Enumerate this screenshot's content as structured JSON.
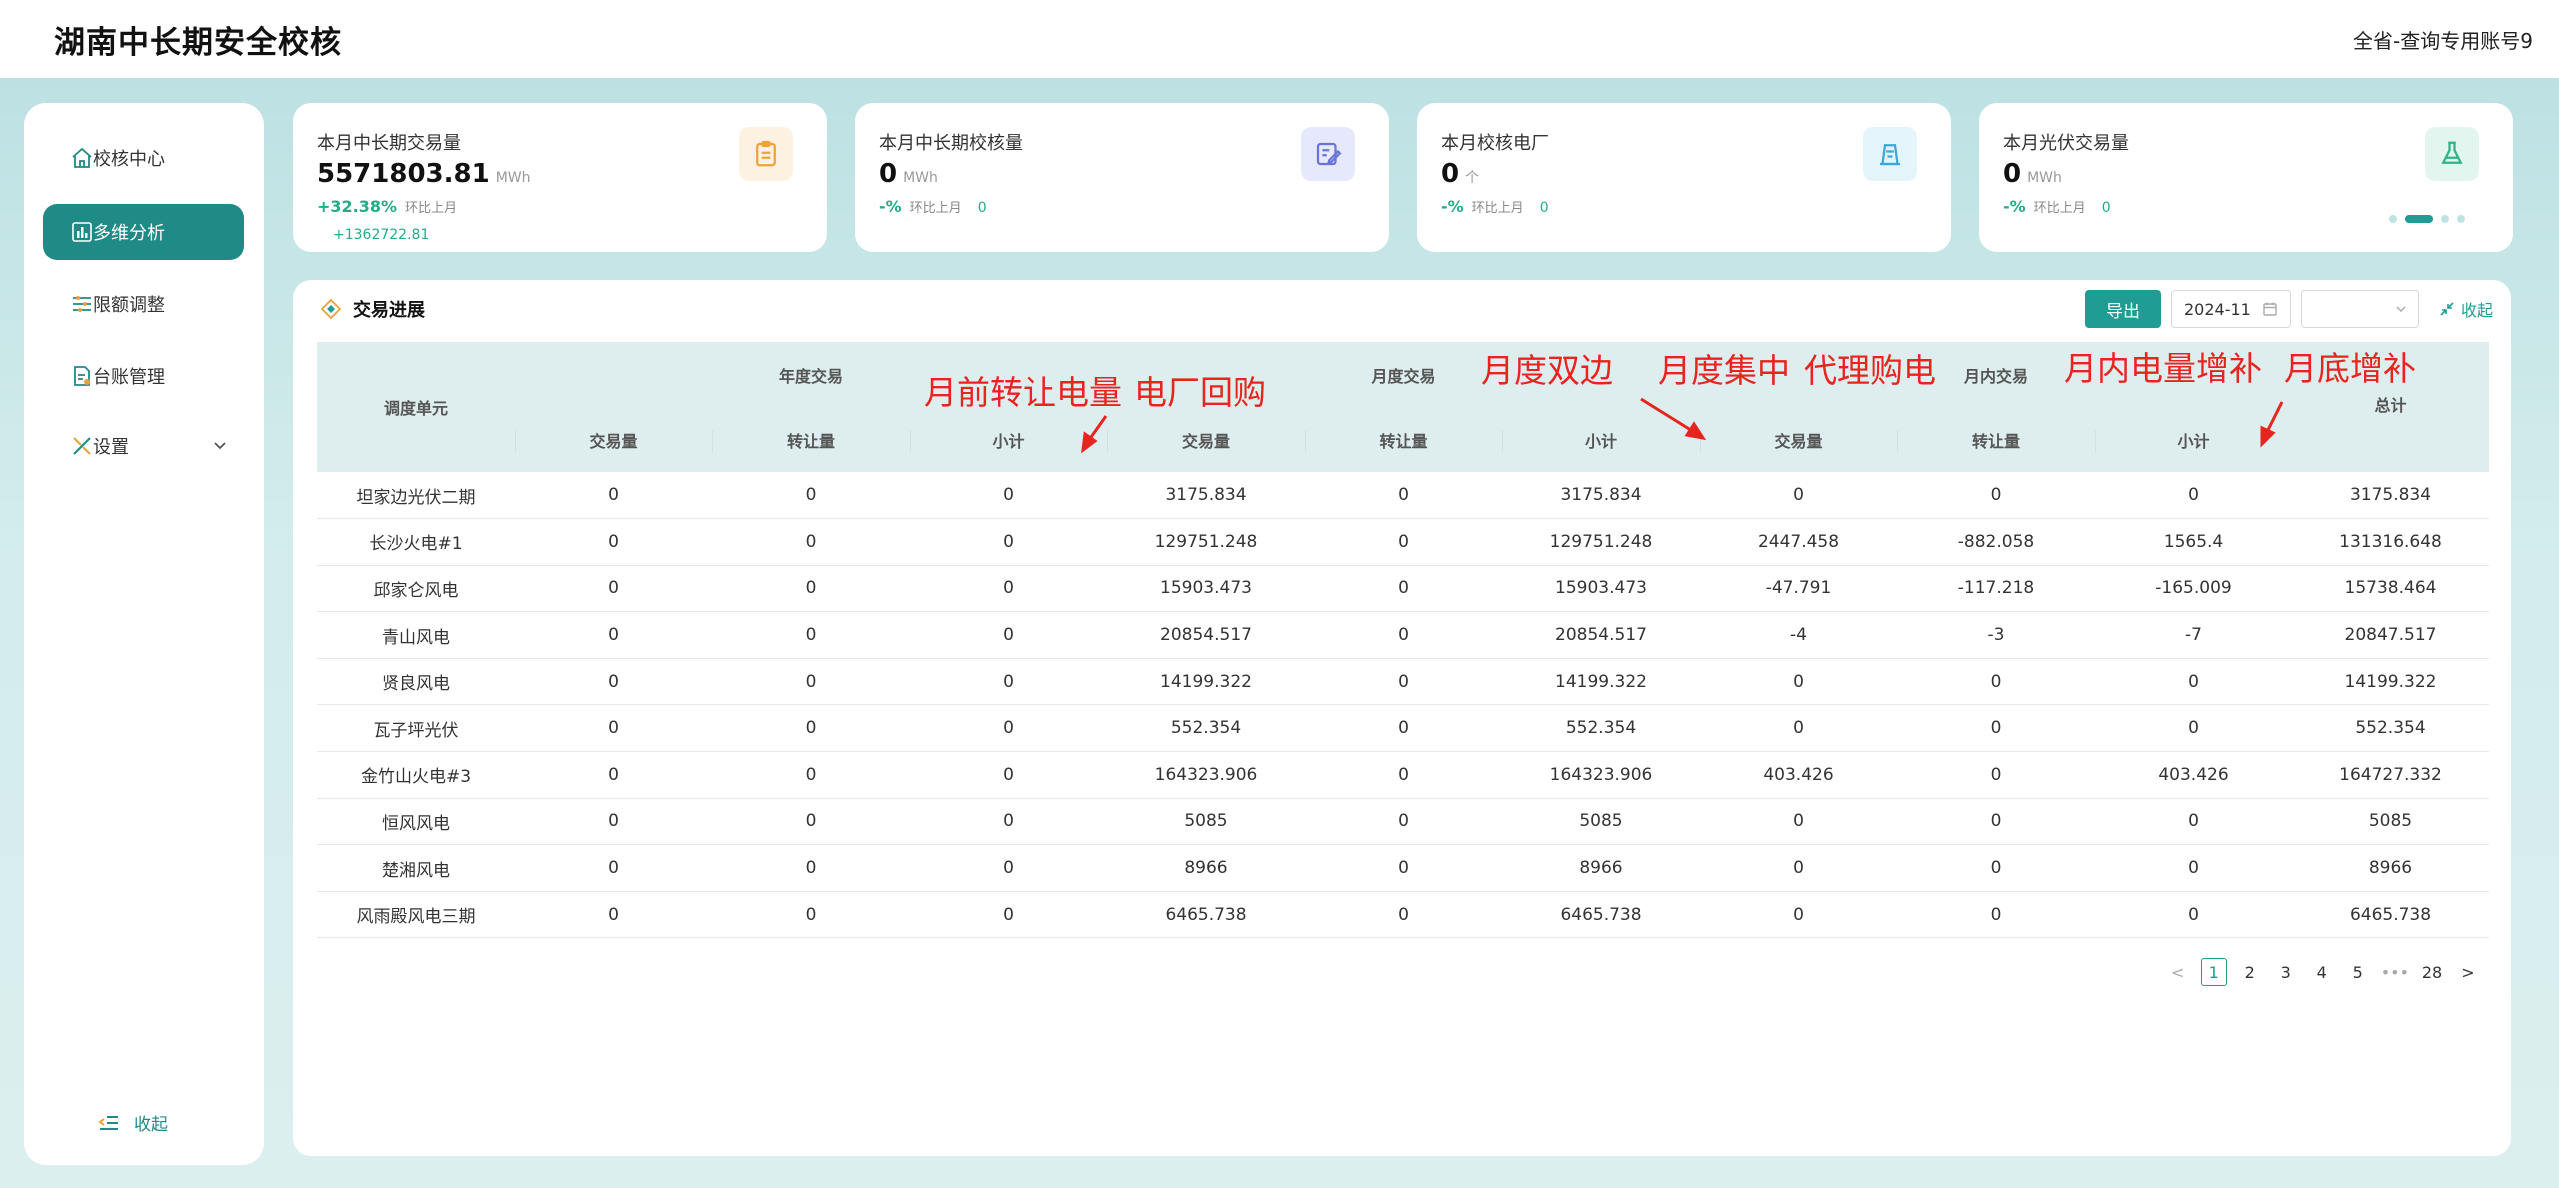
{
  "header": {
    "title": "湖南中长期安全校核",
    "account": "全省-查询专用账号9"
  },
  "sidebar": {
    "items": [
      {
        "label": "校核中心",
        "icon": "home-icon"
      },
      {
        "label": "多维分析",
        "icon": "bar-chart-icon"
      },
      {
        "label": "限额调整",
        "icon": "sliders-icon"
      },
      {
        "label": "台账管理",
        "icon": "ledger-icon"
      },
      {
        "label": "设置",
        "icon": "tools-icon"
      }
    ],
    "collapse": "收起"
  },
  "cards": [
    {
      "label": "本月中长期交易量",
      "value": "5571803.81",
      "unit": "MWh",
      "pct": "+32.38%",
      "pct_label": "环比上月",
      "diff": "+1362722.81",
      "icon": "clipboard-icon"
    },
    {
      "label": "本月中长期校核量",
      "value": "0",
      "unit": "MWh",
      "pct": "-%",
      "pct_label": "环比上月",
      "diff": "0",
      "icon": "edit-doc-icon"
    },
    {
      "label": "本月校核电厂",
      "value": "0",
      "unit": "个",
      "pct": "-%",
      "pct_label": "环比上月",
      "diff": "0",
      "icon": "plant-icon"
    },
    {
      "label": "本月光伏交易量",
      "value": "0",
      "unit": "MWh",
      "pct": "-%",
      "pct_label": "环比上月",
      "diff": "0",
      "icon": "flask-icon"
    }
  ],
  "panel": {
    "title": "交易进展",
    "export": "导出",
    "date": "2024-11",
    "select": "",
    "fold": "收起"
  },
  "table": {
    "groups": {
      "unit": "调度单元",
      "annual": "年度交易",
      "monthly": "月度交易",
      "intra": "月内交易",
      "total": "总计"
    },
    "sub": {
      "qty": "交易量",
      "transfer": "转让量",
      "subtotal": "小计"
    },
    "rows": [
      [
        "坦家边光伏二期",
        "0",
        "0",
        "0",
        "3175.834",
        "0",
        "3175.834",
        "0",
        "0",
        "0",
        "3175.834"
      ],
      [
        "长沙火电#1",
        "0",
        "0",
        "0",
        "129751.248",
        "0",
        "129751.248",
        "2447.458",
        "-882.058",
        "1565.4",
        "131316.648"
      ],
      [
        "邱家仑风电",
        "0",
        "0",
        "0",
        "15903.473",
        "0",
        "15903.473",
        "-47.791",
        "-117.218",
        "-165.009",
        "15738.464"
      ],
      [
        "青山风电",
        "0",
        "0",
        "0",
        "20854.517",
        "0",
        "20854.517",
        "-4",
        "-3",
        "-7",
        "20847.517"
      ],
      [
        "贤良风电",
        "0",
        "0",
        "0",
        "14199.322",
        "0",
        "14199.322",
        "0",
        "0",
        "0",
        "14199.322"
      ],
      [
        "瓦子坪光伏",
        "0",
        "0",
        "0",
        "552.354",
        "0",
        "552.354",
        "0",
        "0",
        "0",
        "552.354"
      ],
      [
        "金竹山火电#3",
        "0",
        "0",
        "0",
        "164323.906",
        "0",
        "164323.906",
        "403.426",
        "0",
        "403.426",
        "164727.332"
      ],
      [
        "恒风风电",
        "0",
        "0",
        "0",
        "5085",
        "0",
        "5085",
        "0",
        "0",
        "0",
        "5085"
      ],
      [
        "楚湘风电",
        "0",
        "0",
        "0",
        "8966",
        "0",
        "8966",
        "0",
        "0",
        "0",
        "8966"
      ],
      [
        "风雨殿风电三期",
        "0",
        "0",
        "0",
        "6465.738",
        "0",
        "6465.738",
        "0",
        "0",
        "0",
        "6465.738"
      ]
    ]
  },
  "pager": {
    "pages": [
      "1",
      "2",
      "3",
      "4",
      "5"
    ],
    "ellipsis": "•••",
    "last": "28",
    "current": "1"
  },
  "annotations": {
    "a1": "月前转让电量",
    "a2": "电厂回购",
    "a3": "月度双边",
    "a4": "月度集中",
    "a5": "代理购电",
    "a6": "月内电量增补",
    "a7": "月底增补"
  },
  "colors": {
    "accent": "#1f9c94",
    "annotation": "#e8241f"
  }
}
